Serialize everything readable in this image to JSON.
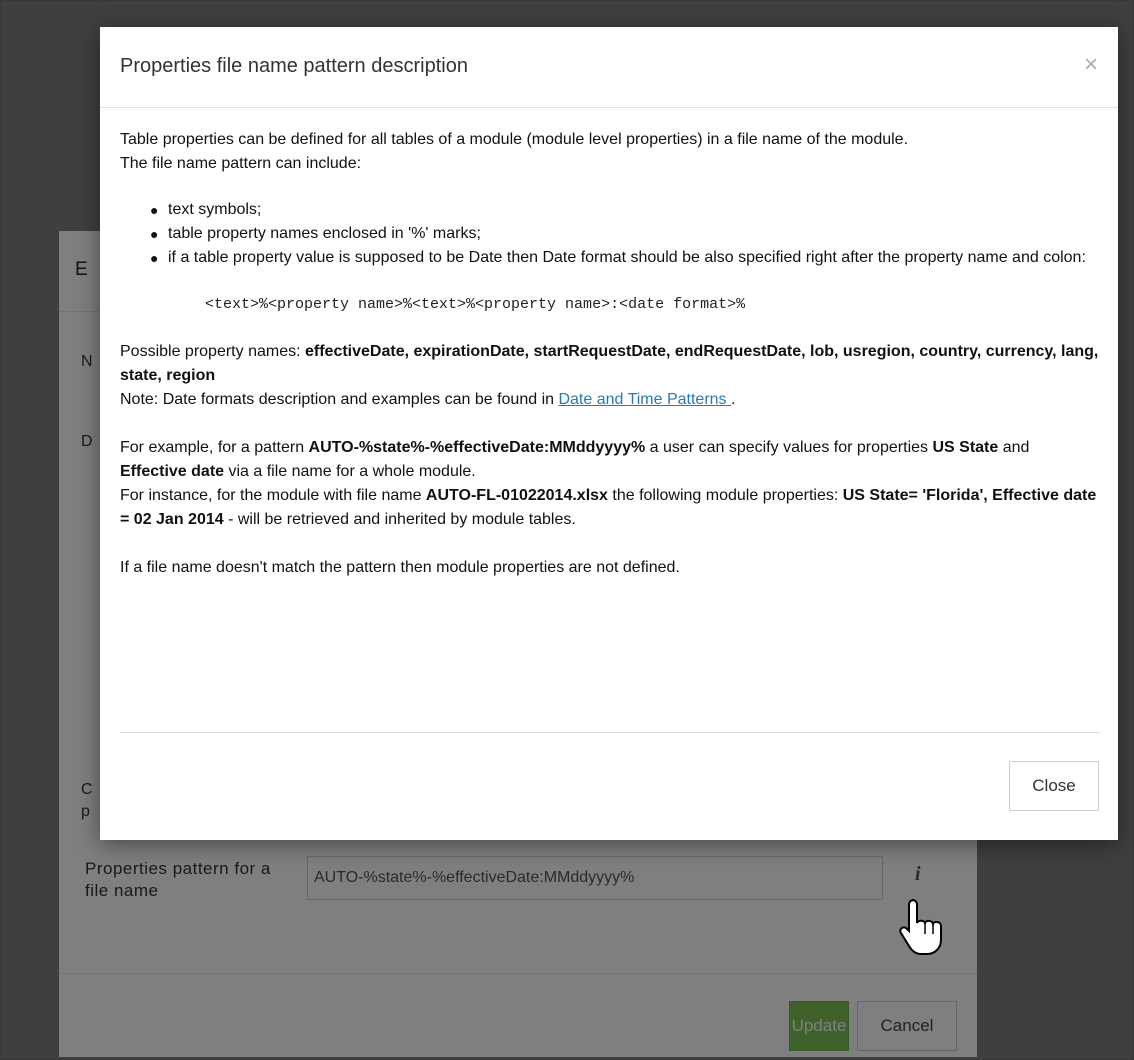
{
  "background_dialog": {
    "header_letter": "E",
    "letter_n": "N",
    "letter_d": "D",
    "letter_c": "C",
    "letter_p": "p",
    "field_label": "Properties pattern for a file name",
    "field_value": "AUTO-%state%-%effectiveDate:MMddyyyy%",
    "info_icon": "info-icon",
    "update_label": "Update",
    "cancel_label": "Cancel"
  },
  "modal": {
    "title": "Properties file name pattern description",
    "close_x": "×",
    "intro_line1": "Table properties can be defined for all tables of a module (module level properties) in a file name of the module.",
    "intro_line2": "The file name pattern can include:",
    "bullets": [
      "text symbols;",
      "table property names enclosed in '%' marks;",
      "if a table property value is supposed to be Date then Date format should be also specified right after the property name and colon:"
    ],
    "syntax": "<text>%<property name>%<text>%<property name>:<date format>%",
    "possible_prefix": "Possible property names: ",
    "possible_names": "effectiveDate, expirationDate, startRequestDate, endRequestDate, lob, usregion, country, currency, lang, state, region",
    "note_prefix": "Note: Date formats description and examples can be found in ",
    "note_link": "Date and Time Patterns ",
    "note_suffix": ".",
    "ex1_a": "For example, for a pattern ",
    "ex1_pattern": "AUTO-%state%-%effectiveDate:MMddyyyy%",
    "ex1_b": " a user can specify values for properties ",
    "ex1_prop1": "US State",
    "ex1_c": " and ",
    "ex1_prop2": "Effective date",
    "ex1_d": " via a file name for a whole module.",
    "ex2_a": "For instance, for the module with file name ",
    "ex2_file": "AUTO-FL-01022014.xlsx",
    "ex2_b": " the following module properties:",
    "ex2_values": "US State= 'Florida', Effective date = 02 Jan 2014",
    "ex2_c": " - will be retrieved and inherited by module tables.",
    "no_match": "If a file name doesn't match the pattern then module properties are not defined.",
    "close_button": "Close"
  }
}
